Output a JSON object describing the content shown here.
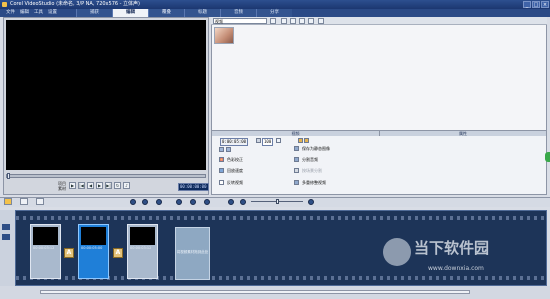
{
  "window": {
    "title": "Corel VideoStudio (未命名, 3/P NA, 720x576 - 立体声)",
    "controls": [
      "_",
      "□",
      "×"
    ]
  },
  "menu": {
    "items": [
      "文件",
      "编辑",
      "工具",
      "设置"
    ]
  },
  "steps": {
    "tabs": [
      {
        "label": "捕获",
        "active": false
      },
      {
        "label": "编辑",
        "active": true
      },
      {
        "label": "覆叠",
        "active": false
      },
      {
        "label": "标题",
        "active": false
      },
      {
        "label": "音频",
        "active": false
      },
      {
        "label": "分享",
        "active": false
      }
    ]
  },
  "preview": {
    "mode_project": "项目",
    "mode_clip": "素材",
    "timecode": "00:00:00:00"
  },
  "library": {
    "category": "视频",
    "thumbnail_icon": "portrait-thumbnail-icon"
  },
  "options": {
    "tabs": [
      "视频",
      "属性"
    ],
    "duration": "0:00:05:00",
    "volume": "100",
    "left_items": [
      "色彩校正",
      "回放速度",
      "反转视频"
    ],
    "right_items": [
      "保存为静态图像",
      "分割音频",
      "按场景分割",
      "多重修整视频"
    ]
  },
  "storyboard": {
    "clips": [
      {
        "label": "00:00:03:12",
        "selected": false
      },
      {
        "label": "00:00:05:00",
        "selected": true
      },
      {
        "label": "00:00:03:12",
        "selected": false
      }
    ],
    "transition_glyph": "A",
    "placeholder": "将视频素材拖到此处"
  },
  "watermark": {
    "name": "当下软件园",
    "url": "www.downxia.com"
  }
}
